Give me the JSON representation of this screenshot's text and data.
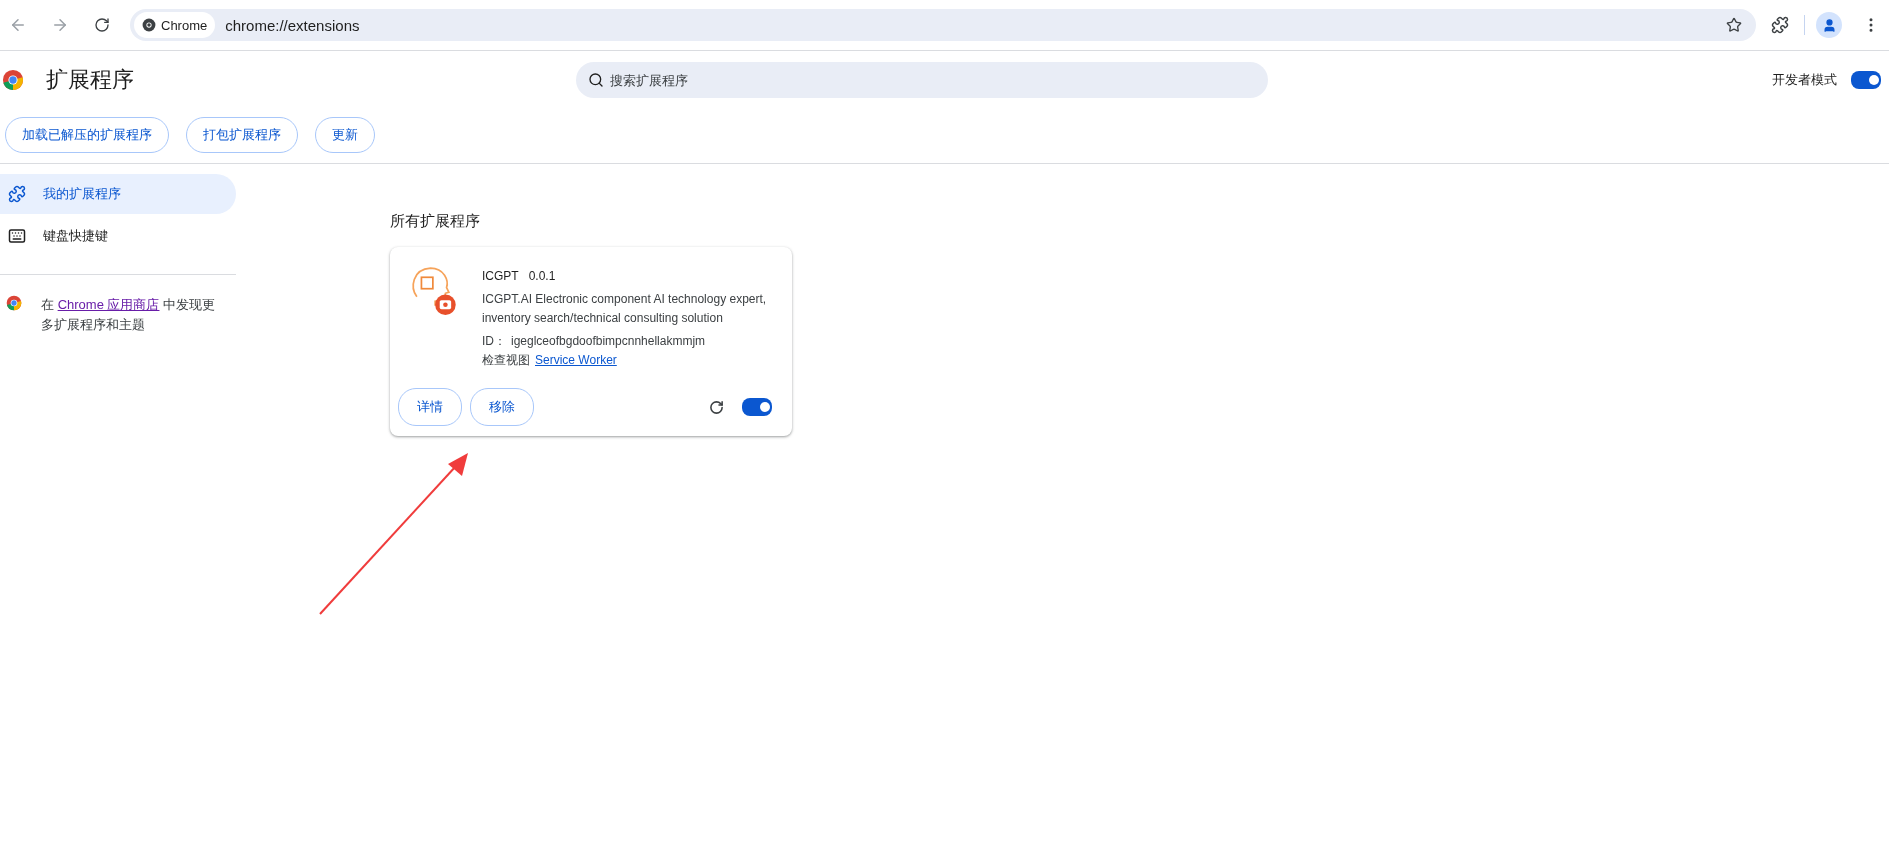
{
  "browser": {
    "site_chip": "Chrome",
    "url": "chrome://extensions"
  },
  "header": {
    "title": "扩展程序",
    "search": {
      "placeholder": "搜索扩展程序"
    },
    "dev_mode": {
      "label": "开发者模式",
      "on": true
    }
  },
  "toolbar_buttons": [
    "加载已解压的扩展程序",
    "打包扩展程序",
    "更新"
  ],
  "sidebar": {
    "items": [
      {
        "label": "我的扩展程序",
        "kind": "extensions",
        "selected": true
      },
      {
        "label": "键盘快捷键",
        "kind": "keyboard",
        "selected": false
      }
    ],
    "store_text": {
      "before": "在 ",
      "link": "Chrome 应用商店",
      "after": " 中发现更多扩展程序和主题"
    }
  },
  "section_title": "所有扩展程序",
  "extensions": [
    {
      "name": "ICGPT",
      "version": "0.0.1",
      "description": "ICGPT.AI Electronic component AI technology expert, inventory search/technical consulting solution",
      "id_label": "ID：",
      "id": "igeglceofbgdoofbimpcnnhellakmmjm",
      "inspect_label": "检查视图",
      "inspect_link": "Service Worker",
      "buttons": [
        "详情",
        "移除"
      ],
      "enabled": true
    }
  ]
}
